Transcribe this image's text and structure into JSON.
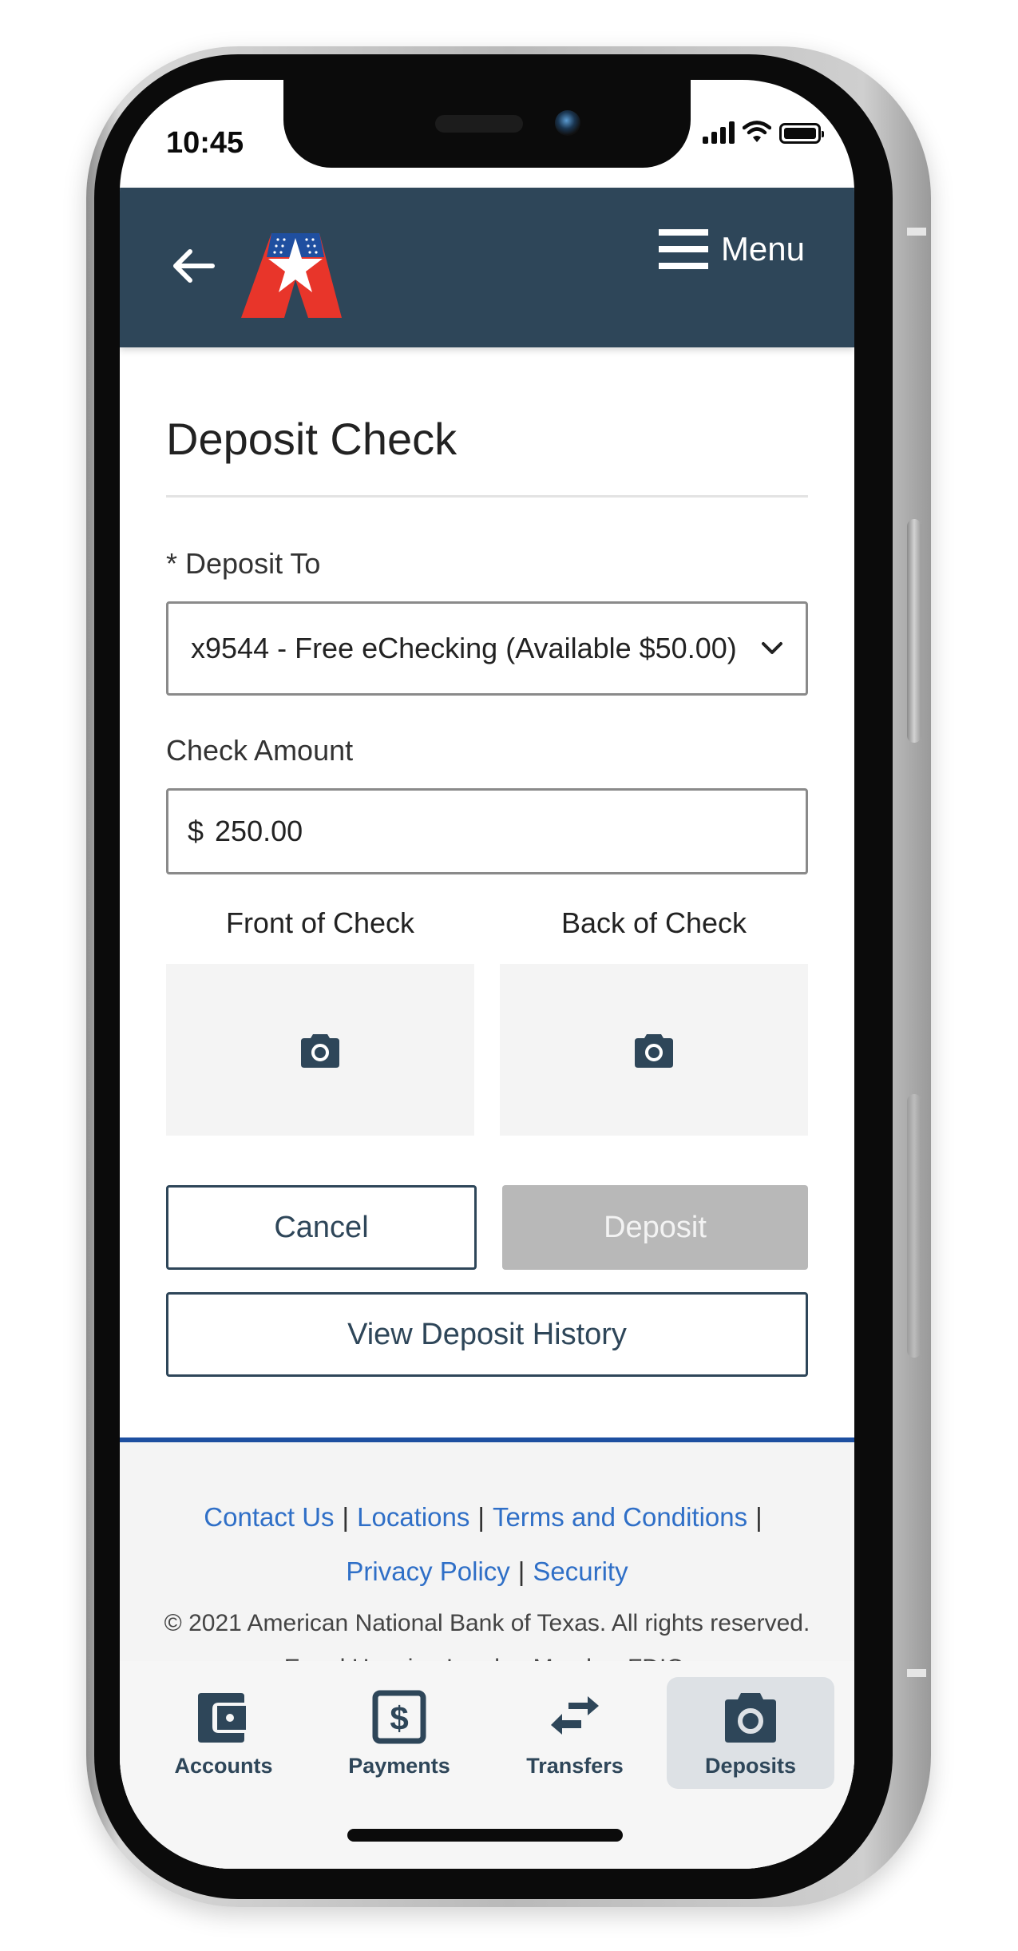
{
  "status_bar": {
    "time": "10:45",
    "icons": [
      "cellular-signal-icon",
      "wifi-icon",
      "battery-icon"
    ]
  },
  "header": {
    "back_icon": "arrow-left-icon",
    "logo": "american-national-bank-logo",
    "menu_icon": "hamburger-icon",
    "menu_label": "Menu",
    "background_color": "#2e4659"
  },
  "page": {
    "title": "Deposit Check"
  },
  "form": {
    "deposit_to": {
      "label": "* Deposit To",
      "selected": "x9544 - Free eChecking (Available $50.00)"
    },
    "check_amount": {
      "label": "Check Amount",
      "currency_symbol": "$",
      "value": "250.00"
    },
    "front_of_check": {
      "label": "Front of Check",
      "icon": "camera-icon"
    },
    "back_of_check": {
      "label": "Back of Check",
      "icon": "camera-icon"
    }
  },
  "buttons": {
    "cancel": "Cancel",
    "deposit": "Deposit",
    "view_history": "View Deposit History"
  },
  "footer": {
    "links": [
      "Contact Us",
      "Locations",
      "Terms and Conditions",
      "Privacy Policy",
      "Security"
    ],
    "separator": "|",
    "copyright": "© 2021 American National Bank of Texas. All rights reserved.",
    "fdic": "Equal Housing Lender. Member FDIC.",
    "link_color": "#2f6fc7",
    "border_color": "#1d4fa0"
  },
  "bottom_nav": {
    "items": [
      {
        "label": "Accounts",
        "icon": "wallet-icon",
        "active": false
      },
      {
        "label": "Payments",
        "icon": "dollar-bill-icon",
        "active": false
      },
      {
        "label": "Transfers",
        "icon": "transfer-arrows-icon",
        "active": false
      },
      {
        "label": "Deposits",
        "icon": "camera-icon",
        "active": true
      }
    ]
  }
}
